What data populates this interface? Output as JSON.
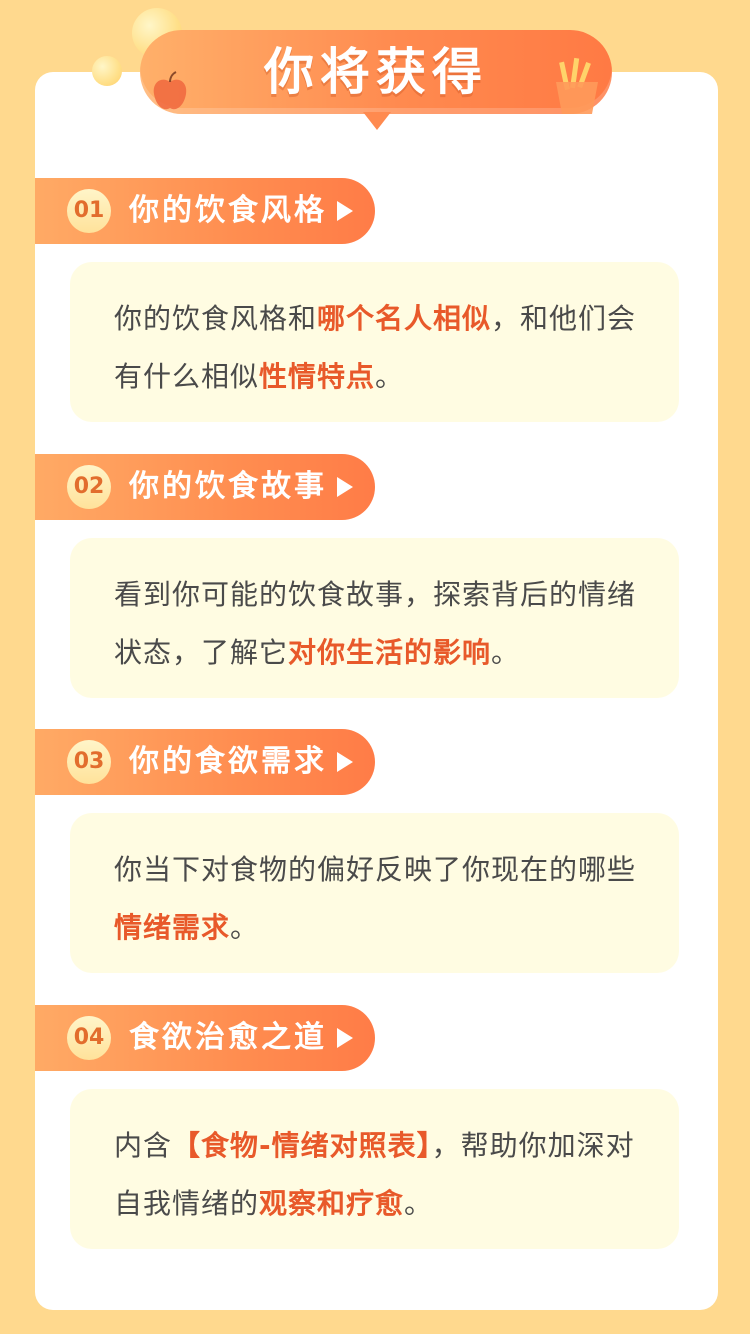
{
  "header": {
    "title": "你将获得"
  },
  "sections": [
    {
      "num": "01",
      "title": "你的饮食风格",
      "text": [
        {
          "t": "你的饮食风格和",
          "hl": false
        },
        {
          "t": "哪个名人相似",
          "hl": true
        },
        {
          "t": "，和他们会有什么相似",
          "hl": false
        },
        {
          "t": "性情特点",
          "hl": true
        },
        {
          "t": "。",
          "hl": false
        }
      ]
    },
    {
      "num": "02",
      "title": "你的饮食故事",
      "text": [
        {
          "t": "看到你可能的饮食故事，探索背后的情绪状态，了解它",
          "hl": false
        },
        {
          "t": "对你生活的影响",
          "hl": true
        },
        {
          "t": "。",
          "hl": false
        }
      ]
    },
    {
      "num": "03",
      "title": "你的食欲需求",
      "text": [
        {
          "t": "你当下对食物的偏好反映了你现在的哪些",
          "hl": false
        },
        {
          "t": "情绪需求",
          "hl": true
        },
        {
          "t": "。",
          "hl": false
        }
      ]
    },
    {
      "num": "04",
      "title": "食欲治愈之道",
      "text": [
        {
          "t": "内含",
          "hl": false
        },
        {
          "t": "【食物-情绪对照表】",
          "hl": true
        },
        {
          "t": "，帮助你加深对自我情绪的",
          "hl": false
        },
        {
          "t": "观察和疗愈",
          "hl": true
        },
        {
          "t": "。",
          "hl": false
        }
      ]
    }
  ],
  "colors": {
    "background": "#ffd98e",
    "accent": "#ff8a4f",
    "highlight": "#e8592a",
    "box": "#fffce2"
  }
}
